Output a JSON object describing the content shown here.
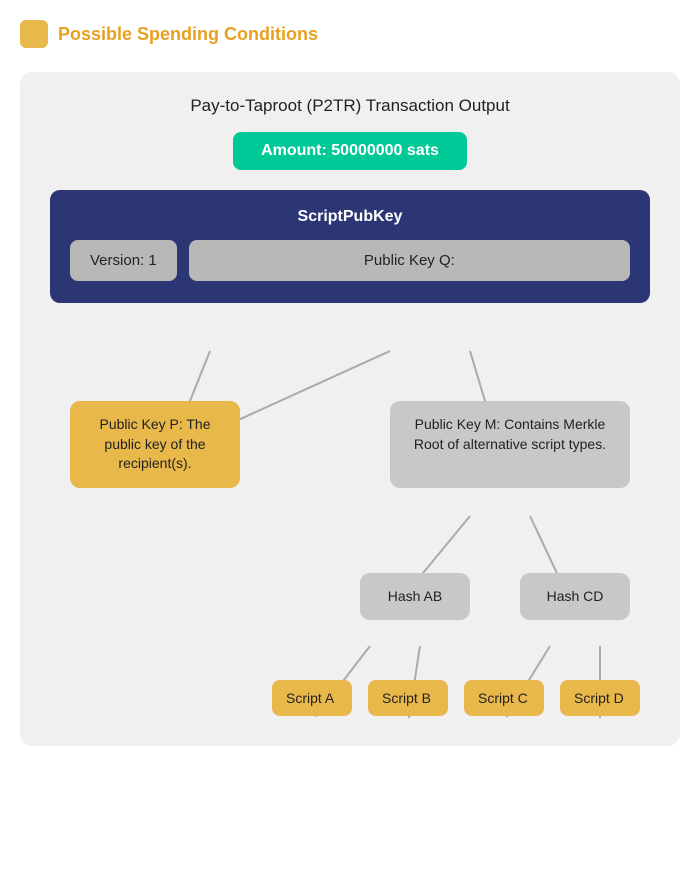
{
  "header": {
    "title": "Possible Spending Conditions"
  },
  "diagram": {
    "outer_title": "Pay-to-Taproot (P2TR) Transaction Output",
    "amount": "Amount: 50000000 sats",
    "scriptpubkey": {
      "title": "ScriptPubKey",
      "version": "Version: 1",
      "pubkey_q": "Public Key Q:"
    },
    "level1": {
      "left": "Public Key P: The public key of the recipient(s).",
      "right": "Public Key M: Contains Merkle Root of alternative script types."
    },
    "level2": {
      "left": "Hash AB",
      "right": "Hash CD"
    },
    "level3": {
      "script_a": "Script A",
      "script_b": "Script B",
      "script_c": "Script C",
      "script_d": "Script D"
    }
  },
  "colors": {
    "gold": "#E8B84B",
    "green": "#00C897",
    "navy": "#2D3675",
    "gray_light": "#b8b8b8",
    "gray_mid": "#c8c8c8",
    "orange_header": "#E8A020"
  }
}
